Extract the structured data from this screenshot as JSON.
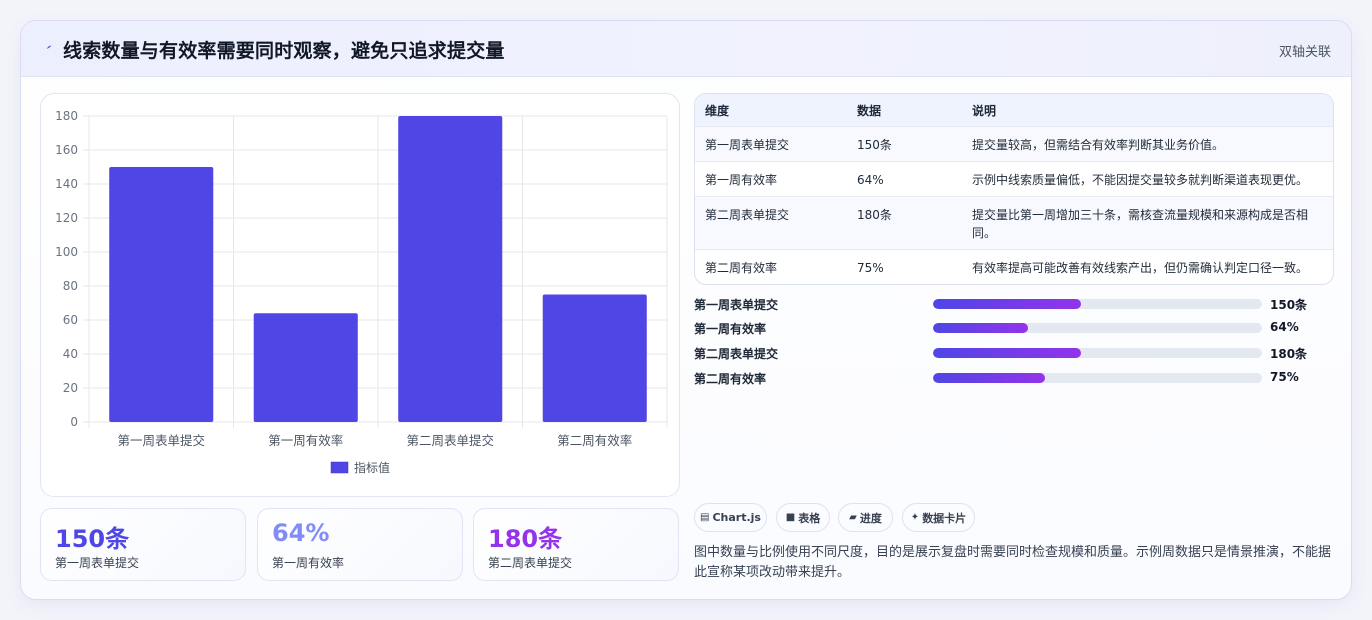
{
  "header": {
    "title": "线索数量与有效率需要同时观察，避免只追求提交量",
    "tag": "双轴关联",
    "icon": "lightning-icon",
    "accent": "#4f46e5"
  },
  "chart_data": {
    "type": "bar",
    "categories": [
      "第一周表单提交",
      "第一周有效率",
      "第二周表单提交",
      "第二周有效率"
    ],
    "series": [
      {
        "name": "指标值",
        "values": [
          150,
          64,
          180,
          75
        ],
        "color": "#4f46e5"
      }
    ],
    "yticks": [
      "180",
      "160",
      "140",
      "120",
      "100",
      "80",
      "60",
      "40",
      "20",
      "0"
    ],
    "ylim": [
      0,
      180
    ],
    "grid": true,
    "legend_position": "bottom"
  },
  "stats": [
    {
      "value": "150条",
      "label": "第一周表单提交",
      "color": "#4f46e5"
    },
    {
      "value": "64%",
      "label": "第一周有效率",
      "color": "#818cf8"
    },
    {
      "value": "180条",
      "label": "第二周表单提交",
      "color": "#9333ea"
    }
  ],
  "table": {
    "headers": [
      "维度",
      "数据",
      "说明"
    ],
    "rows": [
      [
        "第一周表单提交",
        "150条",
        "提交量较高，但需结合有效率判断其业务价值。"
      ],
      [
        "第一周有效率",
        "64%",
        "示例中线索质量偏低，不能因提交量较多就判断渠道表现更优。"
      ],
      [
        "第二周表单提交",
        "180条",
        "提交量比第一周增加三十条，需核查流量规模和来源构成是否相同。"
      ],
      [
        "第二周有效率",
        "75%",
        "有效率提高可能改善有效线索产出，但仍需确认判定口径一致。"
      ]
    ]
  },
  "progress": [
    {
      "label": "第一周表单提交",
      "value": "150条",
      "fraction": 0.45
    },
    {
      "label": "第一周有效率",
      "value": "64%",
      "fraction": 0.29
    },
    {
      "label": "第二周表单提交",
      "value": "180条",
      "fraction": 0.45
    },
    {
      "label": "第二周有效率",
      "value": "75%",
      "fraction": 0.34
    }
  ],
  "chips": [
    {
      "icon": "chart-icon",
      "label": "Chart.js"
    },
    {
      "icon": "table-icon",
      "label": "表格"
    },
    {
      "icon": "progress-icon",
      "label": "进度"
    },
    {
      "icon": "sparkle-icon",
      "label": "数据卡片"
    }
  ],
  "note": "图中数量与比例使用不同尺度，目的是展示复盘时需要同时检查规模和质量。示例周数据只是情景推演，不能据此宣称某项改动带来提升。"
}
